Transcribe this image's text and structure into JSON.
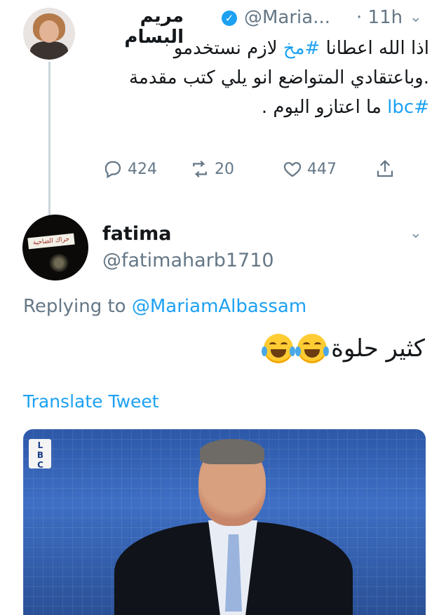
{
  "parent_tweet": {
    "display_name": "مريم البسام",
    "handle": "@Maria...",
    "time": "· 11h",
    "text_before_hashtag1": "اذا الله اعطانا ",
    "hashtag1": "#مخ",
    "text_mid": " لازم نستخدمو .وباعتقادي المتواضع انو يلي كتب مقدمة ",
    "hashtag2": "#lbc",
    "text_after": " ما اعتازو اليوم .",
    "reply_count": "",
    "retweet_count": "20",
    "like_count": "447",
    "view_like_counts": {
      "replies": "424"
    }
  },
  "reply_tweet": {
    "display_name": "fatima",
    "handle": "@fatimaharb1710",
    "replying_to_label": "Replying to",
    "replying_to_mention": "@MariamAlbassam",
    "text": "كثير حلوة",
    "translate_label": "Translate Tweet"
  },
  "media": {
    "logo_text": "LBC"
  },
  "icons": {
    "verified": "verified-badge-icon",
    "reply": "reply-icon",
    "retweet": "retweet-icon",
    "like": "heart-icon",
    "share": "share-icon",
    "more": "chevron-down-icon"
  },
  "colors": {
    "link": "#1da1f2",
    "muted": "#657786",
    "text": "#14171a"
  }
}
